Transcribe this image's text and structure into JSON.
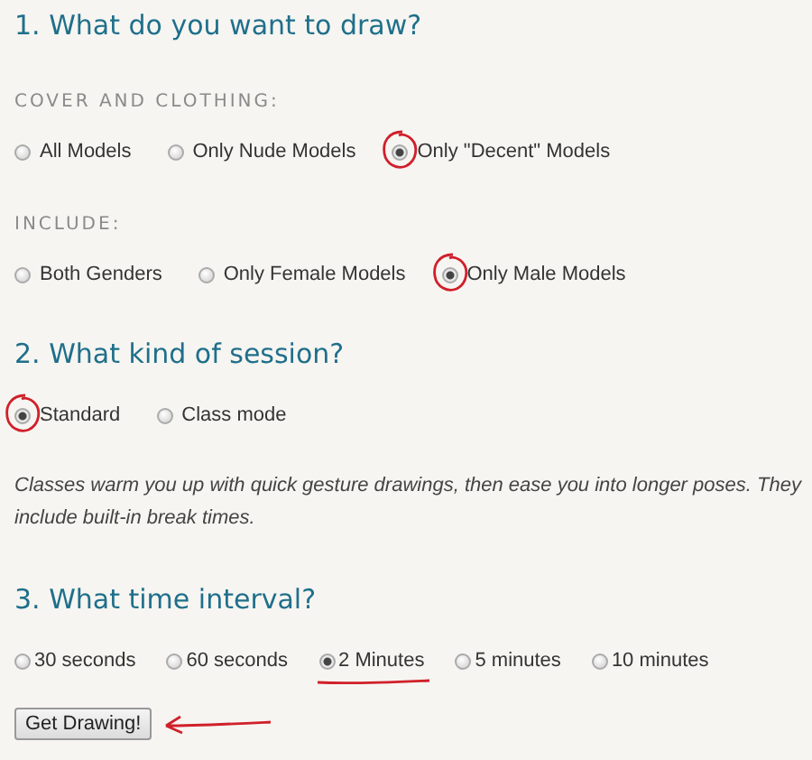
{
  "sections": [
    {
      "heading": "1. What do you want to draw?",
      "groups": [
        {
          "label": "COVER AND CLOTHING:",
          "annotation": {
            "kind": "circle"
          },
          "options": [
            {
              "label": "All Models",
              "selected": false
            },
            {
              "label": "Only Nude Models",
              "selected": false
            },
            {
              "label": "Only \"Decent\" Models",
              "selected": true
            }
          ]
        },
        {
          "label": "INCLUDE:",
          "annotation": {
            "kind": "circle"
          },
          "options": [
            {
              "label": "Both Genders",
              "selected": false
            },
            {
              "label": "Only Female Models",
              "selected": false
            },
            {
              "label": "Only Male Models",
              "selected": true
            }
          ]
        }
      ]
    },
    {
      "heading": "2. What kind of session?",
      "groups": [
        {
          "annotation": {
            "kind": "circle"
          },
          "options": [
            {
              "label": "Standard",
              "selected": true
            },
            {
              "label": "Class mode",
              "selected": false
            }
          ]
        }
      ],
      "note": "Classes warm you up with quick gesture drawings, then ease you into longer poses. They include built-in break times."
    },
    {
      "heading": "3. What time interval?",
      "groups": [
        {
          "annotation": {
            "kind": "underline"
          },
          "options": [
            {
              "label": "30 seconds",
              "selected": false
            },
            {
              "label": "60 seconds",
              "selected": false
            },
            {
              "label": "2 Minutes",
              "selected": true
            },
            {
              "label": "5 minutes",
              "selected": false
            },
            {
              "label": "10 minutes",
              "selected": false
            }
          ]
        }
      ]
    }
  ],
  "submit": {
    "label": "Get Drawing!",
    "annotation": {
      "kind": "arrow"
    }
  }
}
